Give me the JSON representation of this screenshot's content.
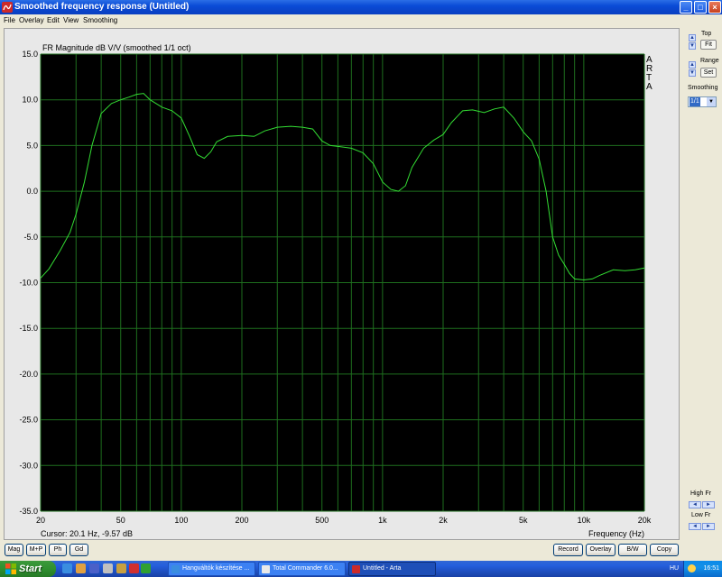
{
  "window": {
    "title": "Smoothed frequency response (Untitled)",
    "menu": [
      "File",
      "Overlay",
      "Edit",
      "View",
      "Smoothing"
    ]
  },
  "plot": {
    "arta_label": [
      "A",
      "R",
      "T",
      "A"
    ],
    "cursor_readout": "Cursor: 20.1 Hz, -9.57 dB"
  },
  "chart_data": {
    "type": "line",
    "title": "FR Magnitude dB V/V (smoothed 1/1 oct)",
    "xlabel": "Frequency (Hz)",
    "ylabel": "",
    "xscale": "log",
    "xlim": [
      20,
      20000
    ],
    "ylim": [
      -35,
      15
    ],
    "grid": true,
    "background": "#000000",
    "line_color": "#33dd33",
    "grid_color": "#1e6e1e",
    "yticks": [
      15,
      10,
      5,
      0,
      -5,
      -10,
      -15,
      -20,
      -25,
      -30,
      -35
    ],
    "ytick_labels": [
      "15.0",
      "10.0",
      "5.0",
      "0.0",
      "-5.0",
      "-10.0",
      "-15.0",
      "-20.0",
      "-25.0",
      "-30.0",
      "-35.0"
    ],
    "xticks": [
      20,
      50,
      100,
      200,
      500,
      1000,
      2000,
      5000,
      10000,
      20000
    ],
    "xtick_labels": [
      "20",
      "50",
      "100",
      "200",
      "500",
      "1k",
      "2k",
      "5k",
      "10k",
      "20k"
    ],
    "series": [
      {
        "x": [
          20,
          22,
          25,
          28,
          30,
          33,
          36,
          40,
          45,
          50,
          55,
          60,
          65,
          70,
          80,
          90,
          100,
          110,
          120,
          130,
          140,
          150,
          170,
          200,
          230,
          260,
          300,
          350,
          400,
          450,
          500,
          550,
          600,
          700,
          800,
          900,
          1000,
          1100,
          1200,
          1300,
          1400,
          1600,
          1800,
          2000,
          2200,
          2500,
          2800,
          3200,
          3600,
          4000,
          4500,
          5000,
          5500,
          6000,
          6500,
          7000,
          7500,
          8000,
          8500,
          9000,
          10000,
          11000,
          12000,
          14000,
          16000,
          18000,
          20000
        ],
        "y": [
          -9.5,
          -8.5,
          -6.5,
          -4.5,
          -2.5,
          1.0,
          5.0,
          8.5,
          9.6,
          10.0,
          10.3,
          10.6,
          10.7,
          10.0,
          9.2,
          8.8,
          8.0,
          6.0,
          4.0,
          3.6,
          4.3,
          5.4,
          6.0,
          6.1,
          6.0,
          6.6,
          7.0,
          7.1,
          7.0,
          6.8,
          5.5,
          5.0,
          4.9,
          4.7,
          4.2,
          3.0,
          1.0,
          0.2,
          0.0,
          0.6,
          2.6,
          4.7,
          5.6,
          6.2,
          7.5,
          8.8,
          8.9,
          8.6,
          9.0,
          9.2,
          8.0,
          6.5,
          5.5,
          3.5,
          0.0,
          -5.0,
          -7.0,
          -8.0,
          -9.0,
          -9.6,
          -9.7,
          -9.6,
          -9.2,
          -8.6,
          -8.7,
          -8.6,
          -8.4
        ]
      }
    ]
  },
  "side_panel": {
    "top_label": "Top",
    "fit_label": "Fit",
    "range_label": "Range",
    "set_label": "Set",
    "smoothing_label": "Smoothing",
    "smoothing_value": "1/1",
    "high_fr_label": "High Fr",
    "low_fr_label": "Low Fr"
  },
  "bottom_buttons": {
    "left": [
      "Mag",
      "M+P",
      "Ph",
      "Gd"
    ],
    "right": [
      "Record",
      "Overlay",
      "B/W",
      "Copy"
    ]
  },
  "taskbar": {
    "start_label": "Start",
    "tasks": [
      "Hangváltók készítése ...",
      "Total Commander 6.0...",
      "Untitled - Arta"
    ],
    "language": "HU",
    "clock": "16:51"
  }
}
